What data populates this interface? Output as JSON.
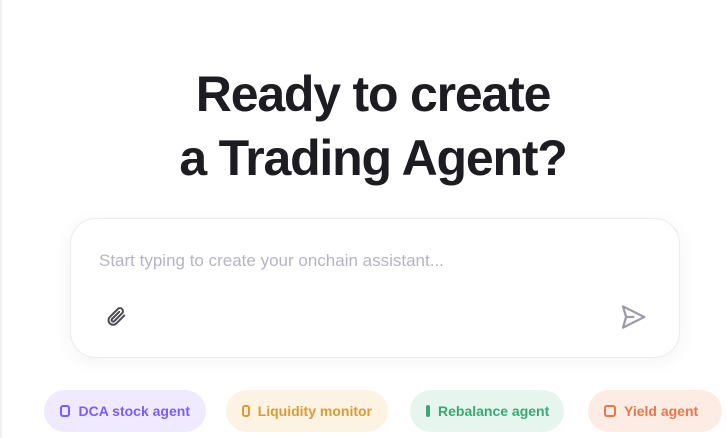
{
  "hero": {
    "line1": "Ready to create",
    "line2": "a Trading Agent?"
  },
  "prompt": {
    "placeholder": "Start typing to create your onchain assistant...",
    "attach_icon": "paperclip-icon",
    "send_icon": "send-icon"
  },
  "chips": [
    {
      "label": "DCA stock agent",
      "icon": "bot-icon",
      "color": "#7b5cff",
      "bg": "#efeaff"
    },
    {
      "label": "Liquidity monitor",
      "icon": "chart-icon",
      "color": "#d89a3a",
      "bg": "#fdf3e3"
    },
    {
      "label": "Rebalance agent",
      "icon": "refresh-icon",
      "color": "#3aa872",
      "bg": "#e6f6ee"
    },
    {
      "label": "Yield agent",
      "icon": "coins-icon",
      "color": "#e8774a",
      "bg": "#fdece4"
    }
  ]
}
